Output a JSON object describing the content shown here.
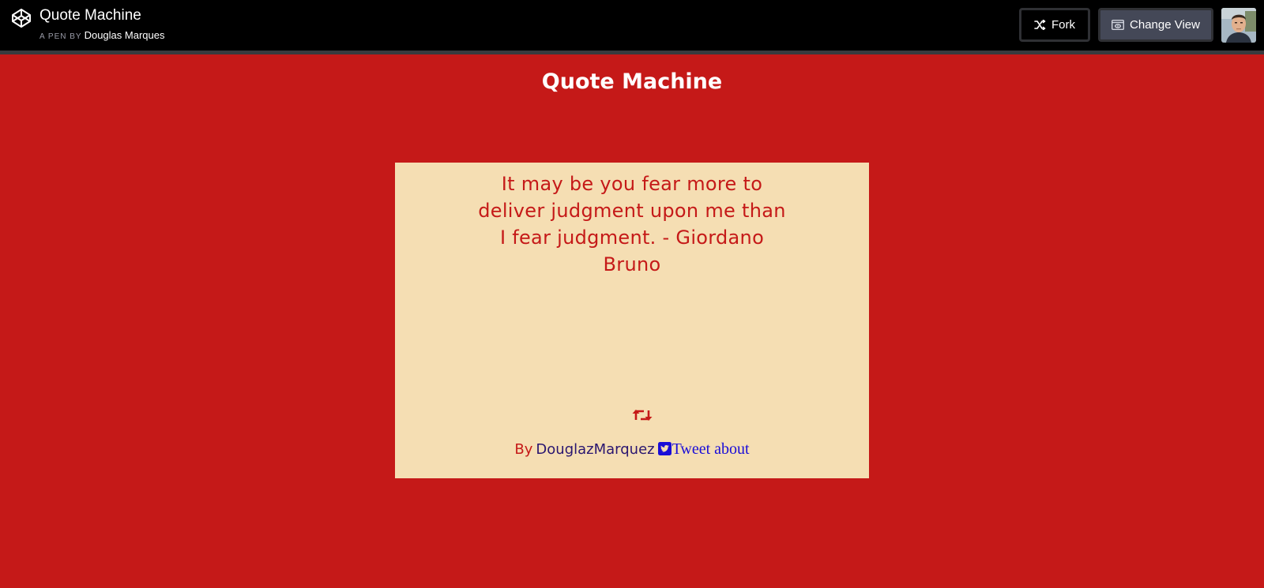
{
  "header": {
    "pen_title": "Quote Machine",
    "byline_prefix": "A PEN BY",
    "author": "Douglas Marques",
    "fork_label": "Fork",
    "change_view_label": "Change View",
    "logo_icon": "codepen-logo-icon",
    "fork_icon": "fork-icon",
    "change_view_icon": "change-view-icon"
  },
  "main": {
    "heading": "Quote Machine",
    "quote": "It may be you fear more to deliver judgment upon me than I fear judgment. - Giordano Bruno",
    "refresh_icon": "retweet-icon",
    "credit_prefix": "By",
    "credit_author": "DouglazMarquez",
    "tweet_label": "Tweet about",
    "tweet_icon": "twitter-square-icon"
  },
  "colors": {
    "background": "#c51918",
    "card": "#f5deb3",
    "quote_text": "#c51918",
    "topbar": "#000000",
    "link": "#1a0dd8"
  }
}
